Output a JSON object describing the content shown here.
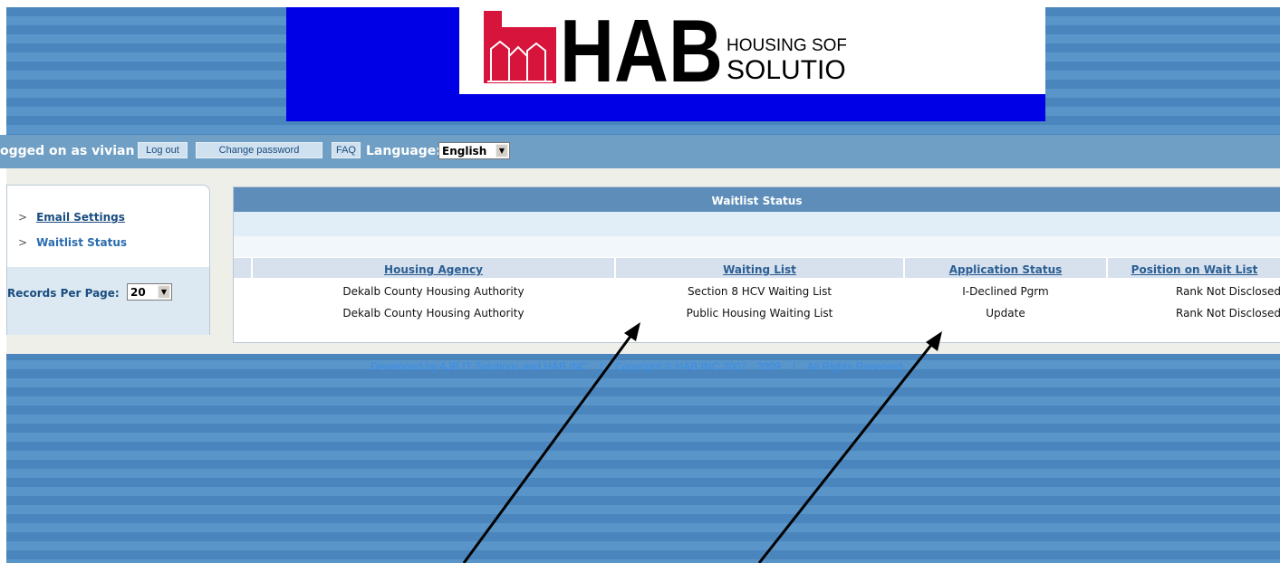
{
  "logo": {
    "letters": "HAB",
    "tagline_line1": "HOUSING SOFTWARE",
    "tagline_line2": "SOLUTIONS",
    "colors": {
      "red": "#d6143c",
      "black": "#000000",
      "blue_panel": "#0000e6"
    }
  },
  "toolbar": {
    "logged_on": "ogged on as vivian",
    "logout_label": "Log out",
    "change_password_label": "Change password",
    "faq_label": "FAQ",
    "language_label": "Language:",
    "language_value": "English"
  },
  "sidebar": {
    "items": [
      {
        "label": "Email Settings",
        "current": false
      },
      {
        "label": "Waitlist Status",
        "current": true
      }
    ],
    "records_label": "Records Per Page:",
    "records_value": "20"
  },
  "table": {
    "title": "Waitlist Status",
    "headers": [
      "Housing Agency",
      "Waiting List",
      "Application Status",
      "Position on Wait List"
    ],
    "rows": [
      [
        "Dekalb County Housing Authority",
        "Section 8 HCV Waiting List",
        "I-Declined Pgrm",
        "Rank Not Disclosed"
      ],
      [
        "Dekalb County Housing Authority",
        "Public Housing Waiting List",
        "Update",
        "Rank Not Disclosed"
      ]
    ]
  },
  "footer": {
    "text": "Developed by AJB IT Solutions and HAB INC    |    Copyright © HAB INC 2007 - 2009    |    All Rights Reserved"
  },
  "arrow_icon": "arrow-annotation-icon"
}
